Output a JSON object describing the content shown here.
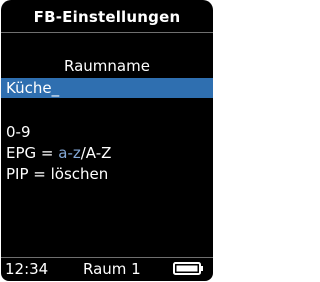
{
  "header": {
    "title": "FB-Einstellungen"
  },
  "field": {
    "label": "Raumname",
    "value": "Küche_"
  },
  "hints": {
    "digits": "0-9",
    "epg_key": "EPG = ",
    "epg_lower": "a-z",
    "epg_upper": "/A-Z",
    "pip": "PIP  = löschen"
  },
  "status_bar": {
    "time": "12:34",
    "room": "Raum 1",
    "battery_icon": "battery-icon",
    "battery_level": 1.0
  },
  "colors": {
    "screen_background": "#000000",
    "highlight": "#2f6fb0",
    "accent_text": "#84a9d8",
    "text": "#ffffff"
  }
}
